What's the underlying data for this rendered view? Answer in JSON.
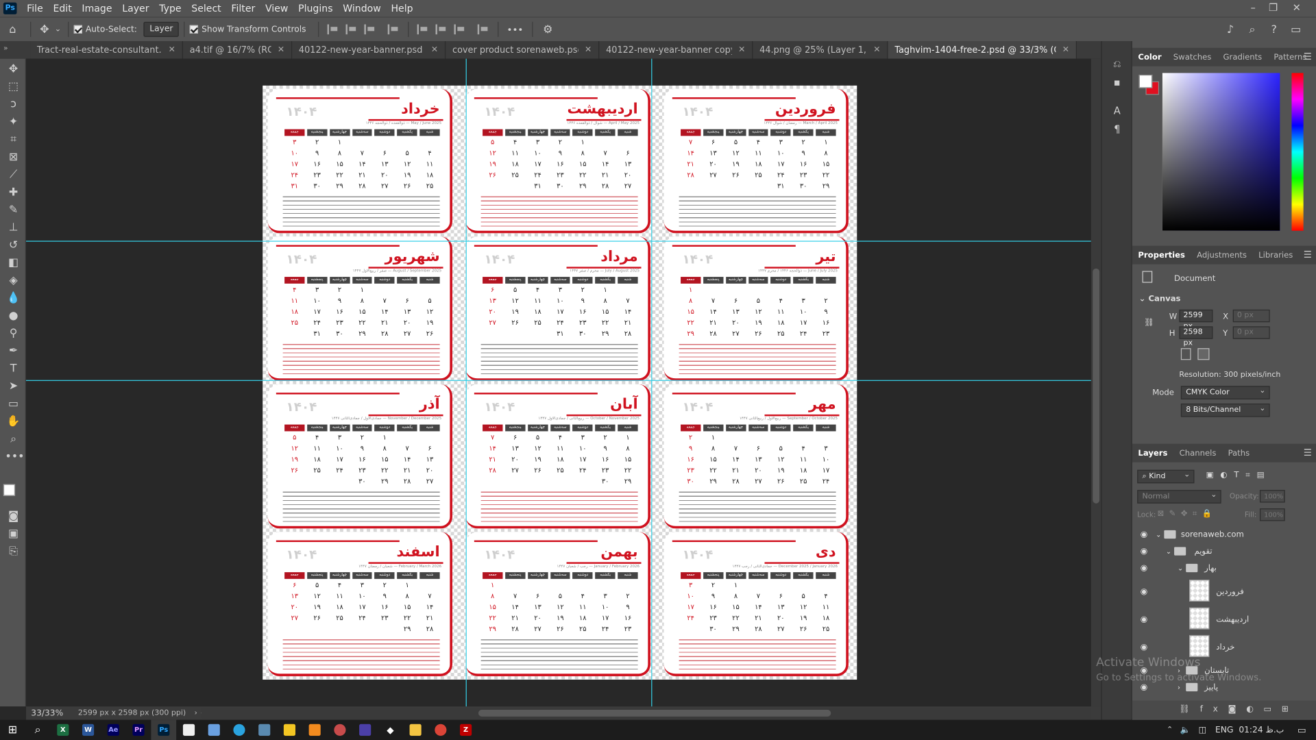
{
  "menubar": {
    "app_icon": "Ps",
    "items": [
      "File",
      "Edit",
      "Image",
      "Layer",
      "Type",
      "Select",
      "Filter",
      "View",
      "Plugins",
      "Window",
      "Help"
    ]
  },
  "options": {
    "auto_select_label": "Auto-Select:",
    "auto_select_value": "Layer",
    "show_transform_label": "Show Transform Controls",
    "more": "•••"
  },
  "tabs": [
    {
      "label": "Tract-real-estate-consultant.psd",
      "active": false
    },
    {
      "label": "a4.tif @ 16/7% (RGB/...",
      "active": false
    },
    {
      "label": "40122-new-year-banner.psd @ 33...",
      "active": false
    },
    {
      "label": "cover product sorenaweb.psd @ 6...",
      "active": false
    },
    {
      "label": "40122-new-year-banner copy.png",
      "active": false
    },
    {
      "label": "44.png @ 25% (Layer 1, RGB...",
      "active": false
    },
    {
      "label": "Taghvim-1404-free-2.psd @ 33/3% (CMYK/8*)",
      "active": true
    }
  ],
  "calendar": {
    "year": "۱۴۰۴",
    "weekdays": [
      "شنبه",
      "یکشنبه",
      "دوشنبه",
      "سه‌شنبه",
      "چهارشنبه",
      "پنجشنبه",
      "جمعه"
    ],
    "months": [
      {
        "name": "فروردین",
        "sub": "رمضان / شوال ۱۴۴۶ — March / April 2025"
      },
      {
        "name": "اردیبهشت",
        "sub": "شوال / ذوالقعده ۱۴۴۶ — April / May 2025"
      },
      {
        "name": "خرداد",
        "sub": "ذوالقعده / ذوالحجه ۱۴۴۶ — May / June 2025"
      },
      {
        "name": "تیر",
        "sub": "ذوالحجه ۱۴۴۶ / محرم ۱۴۴۷ — June / July 2025"
      },
      {
        "name": "مرداد",
        "sub": "محرم / صفر ۱۴۴۷ — July / August 2025"
      },
      {
        "name": "شهریور",
        "sub": "صفر / ربیع‌الاول ۱۴۴۷ — August / September 2025"
      },
      {
        "name": "مهر",
        "sub": "ربیع‌الاول / ربیع‌الثانی ۱۴۴۷ — September / October 2025"
      },
      {
        "name": "آبان",
        "sub": "ربیع‌الثانی / جمادی‌الاول ۱۴۴۷ — October / November 2025"
      },
      {
        "name": "آذر",
        "sub": "جمادی‌الاول / جمادی‌الثانی ۱۴۴۷ — November / December 2025"
      },
      {
        "name": "دی",
        "sub": "جمادی‌الثانی / رجب ۱۴۴۷ — December 2025 / January 2026"
      },
      {
        "name": "بهمن",
        "sub": "رجب / شعبان ۱۴۴۷ — January / February 2026"
      },
      {
        "name": "اسفند",
        "sub": "شعبان / رمضان ۱۴۴۷ — February / March 2026"
      }
    ]
  },
  "status": {
    "zoom": "33/33%",
    "doc_info": "2599 px x 2598 px (300 ppi)"
  },
  "color_panel": {
    "tabs": [
      "Color",
      "Swatches",
      "Gradients",
      "Patterns"
    ],
    "fg": "#ffffff",
    "bg": "#e01020"
  },
  "properties": {
    "tabs": [
      "Properties",
      "Adjustments",
      "Libraries"
    ],
    "doc_label": "Document",
    "canvas_label": "Canvas",
    "w_label": "W",
    "w_value": "2599 px",
    "h_label": "H",
    "h_value": "2598 px",
    "x_label": "X",
    "x_value": "0 px",
    "y_label": "Y",
    "y_value": "0 px",
    "resolution": "Resolution: 300 pixels/inch",
    "mode_label": "Mode",
    "mode_value": "CMYK Color",
    "bits_value": "8 Bits/Channel"
  },
  "layers": {
    "tabs": [
      "Layers",
      "Channels",
      "Paths"
    ],
    "kind": "Kind",
    "blend": "Normal",
    "opacity_label": "Opacity:",
    "opacity_value": "100%",
    "lock_label": "Lock:",
    "fill_label": "Fill:",
    "fill_value": "100%",
    "items": [
      {
        "name": "sorenaweb.com",
        "type": "group"
      },
      {
        "name": "تقویم",
        "type": "group"
      },
      {
        "name": "بهار",
        "type": "group"
      },
      {
        "name": "فروردین",
        "type": "layer"
      },
      {
        "name": "اردیبهشت",
        "type": "layer"
      },
      {
        "name": "خرداد",
        "type": "layer"
      },
      {
        "name": "تابستان",
        "type": "group"
      },
      {
        "name": "پاییز",
        "type": "group"
      }
    ]
  },
  "watermark": {
    "line1": "Activate Windows",
    "line2": "Go to Settings to activate Windows."
  },
  "taskbar": {
    "lang": "ENG",
    "time": "01:24 ب.ظ"
  }
}
